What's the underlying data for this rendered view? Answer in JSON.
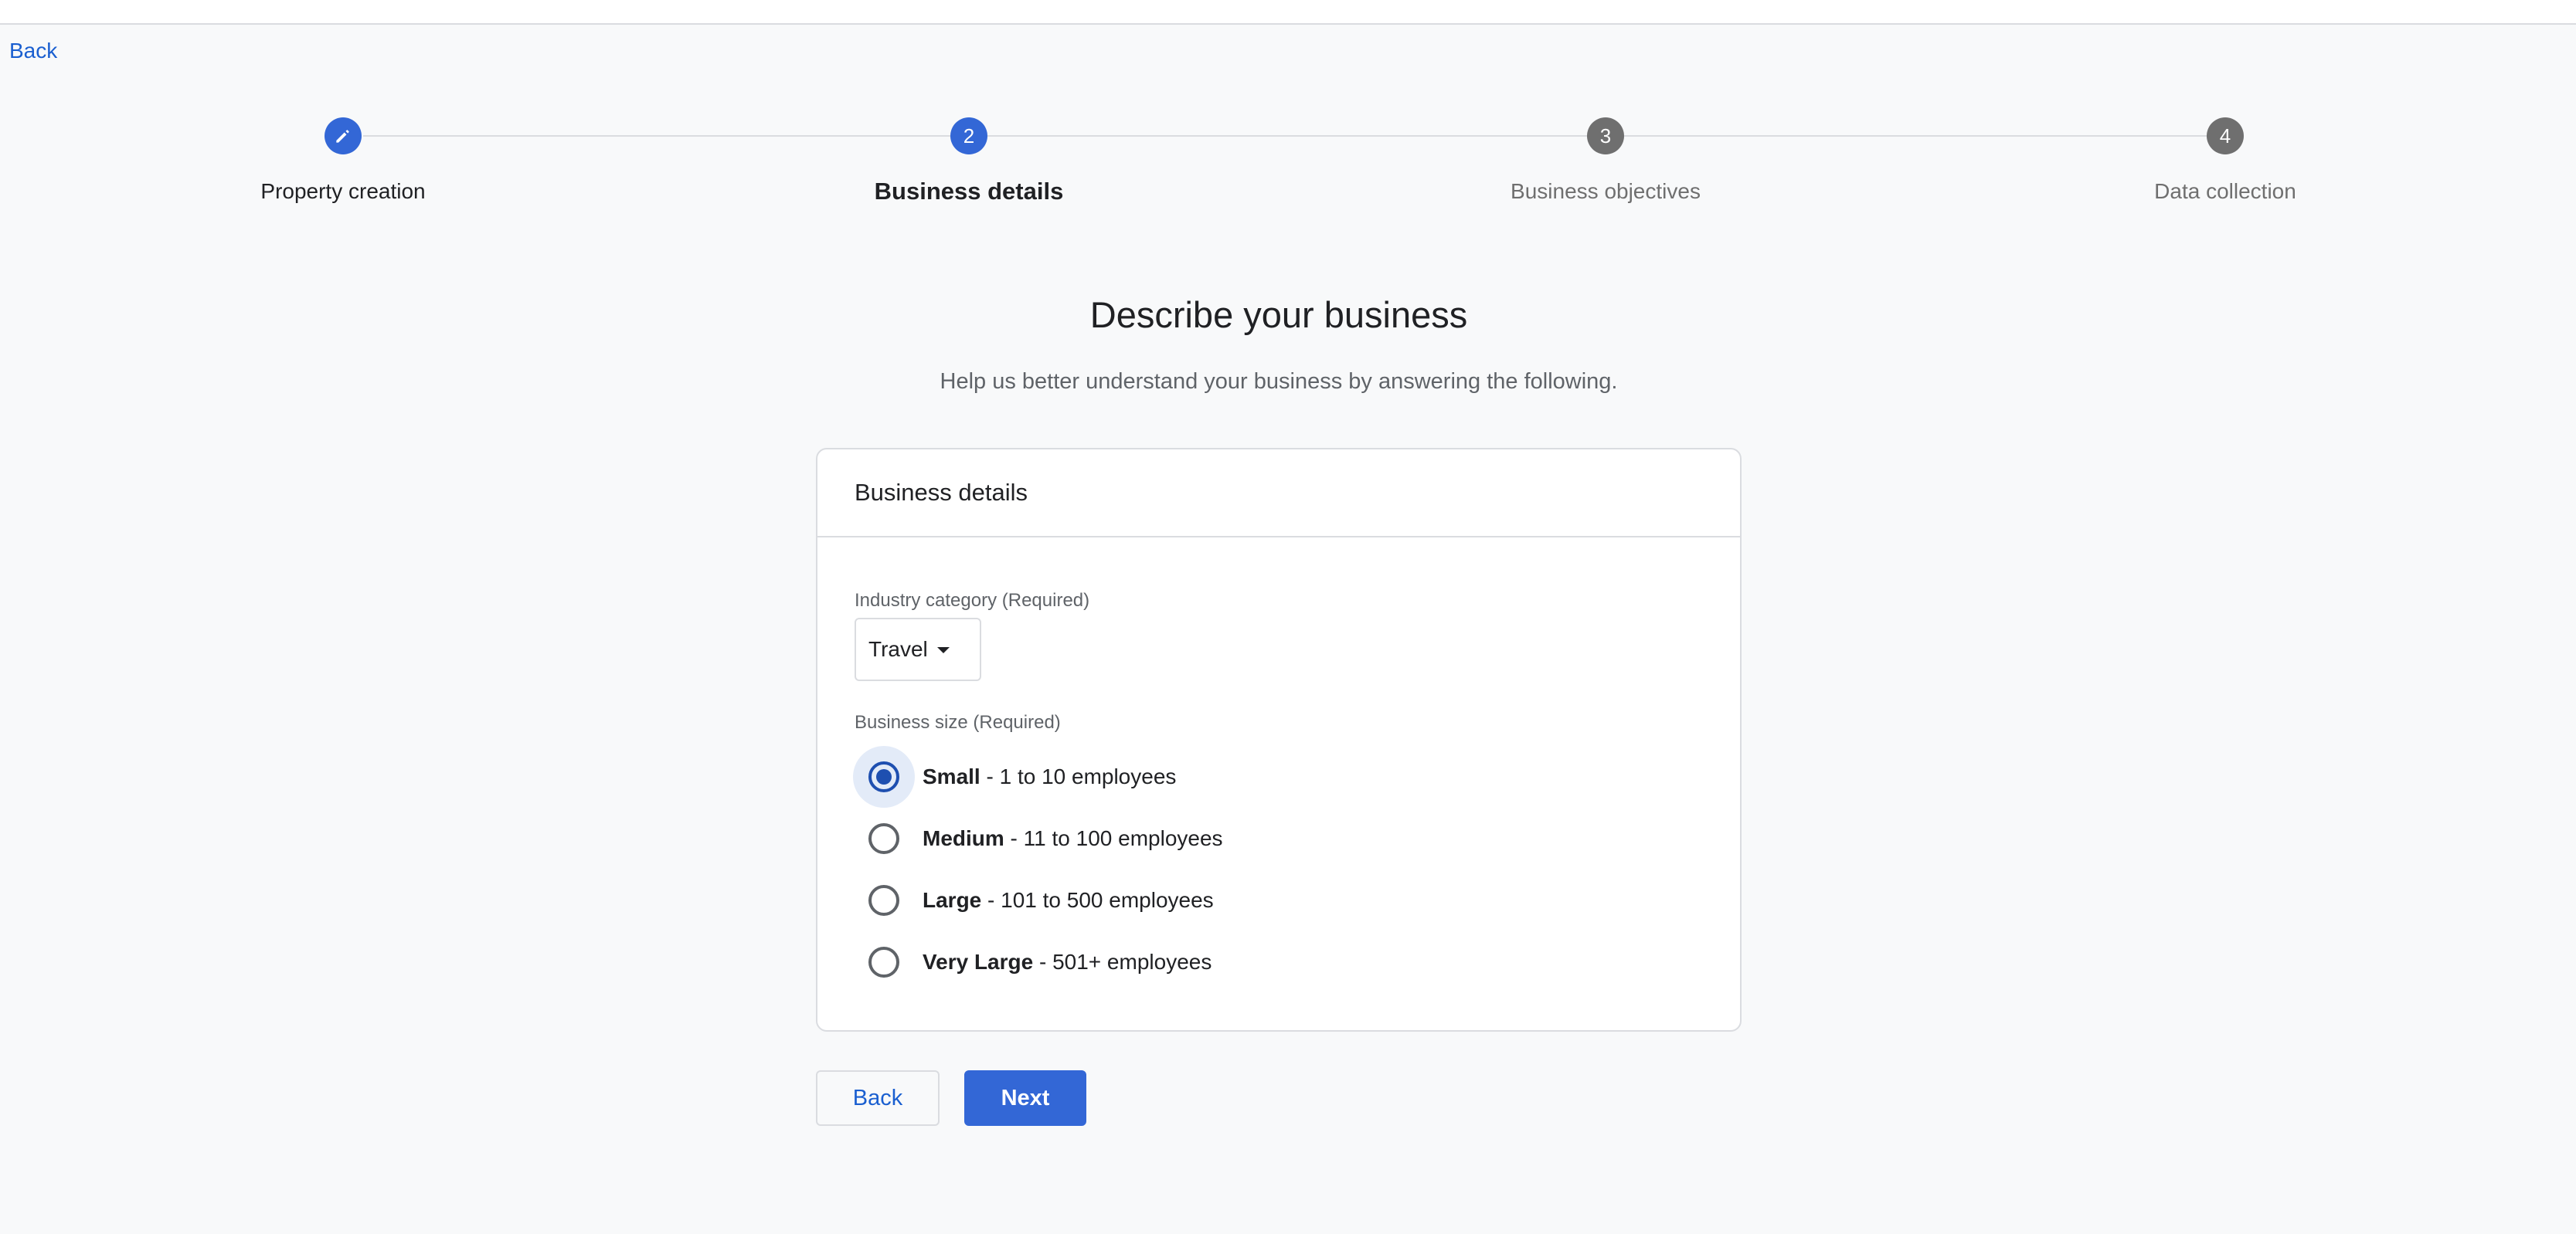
{
  "nav": {
    "back_label": "Back"
  },
  "stepper": {
    "steps": [
      {
        "label": "Property creation",
        "status": "completed",
        "icon": "pencil-icon"
      },
      {
        "label": "Business details",
        "number": "2",
        "status": "current"
      },
      {
        "label": "Business objectives",
        "number": "3",
        "status": "upcoming"
      },
      {
        "label": "Data collection",
        "number": "4",
        "status": "upcoming"
      }
    ]
  },
  "page": {
    "title": "Describe your business",
    "subtitle": "Help us better understand your business by answering the following."
  },
  "card": {
    "title": "Business details",
    "industry": {
      "label": "Industry category (Required)",
      "value": "Travel"
    },
    "size": {
      "label": "Business size (Required)",
      "options": [
        {
          "name": "Small",
          "detail": " - 1 to 10 employees",
          "selected": true
        },
        {
          "name": "Medium",
          "detail": " - 11 to 100 employees",
          "selected": false
        },
        {
          "name": "Large",
          "detail": " - 101 to 500 employees",
          "selected": false
        },
        {
          "name": "Very Large",
          "detail": " - 501+ employees",
          "selected": false
        }
      ]
    }
  },
  "actions": {
    "back_label": "Back",
    "next_label": "Next"
  },
  "colors": {
    "accent": "#3367d6",
    "link": "#1a5fd0",
    "inactive_step": "#6f6f6f",
    "radio_selected": "#1e4fb0",
    "background": "#f8f9fa",
    "border": "#dadce0"
  }
}
